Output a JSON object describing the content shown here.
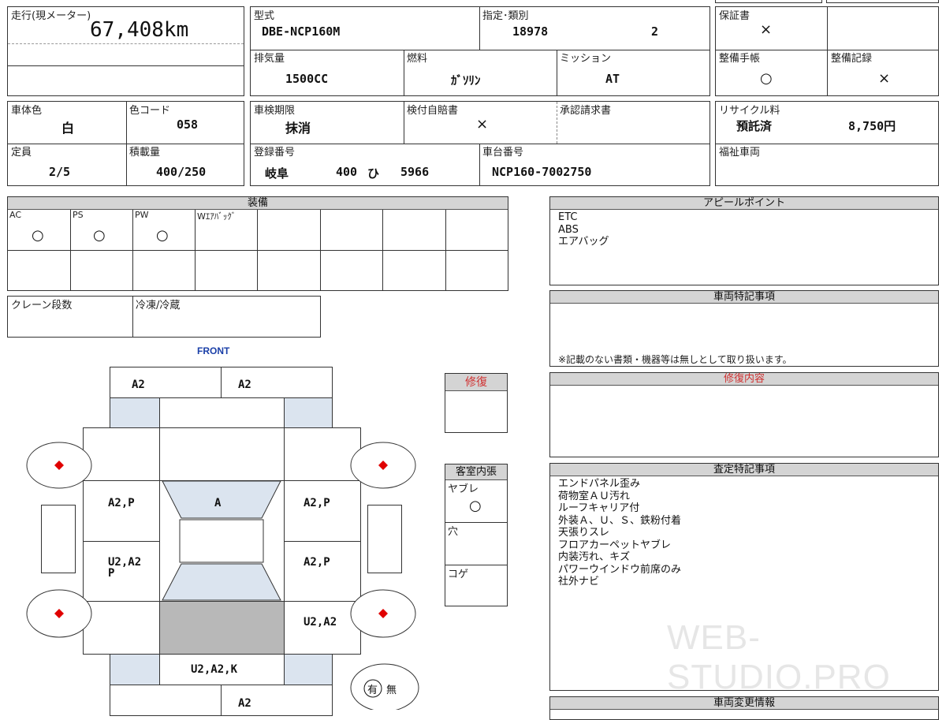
{
  "mileage": {
    "label": "走行(現メーター)",
    "value": "67,408km"
  },
  "model": {
    "label": "型式",
    "value": "DBE-NCP160M"
  },
  "designation": {
    "label": "指定･類別",
    "number": "18978",
    "class": "2"
  },
  "warranty": {
    "label": "保証書",
    "value": "×"
  },
  "displacement": {
    "label": "排気量",
    "value": "1500CC"
  },
  "fuel": {
    "label": "燃料",
    "value": "ｶﾞｿﾘﾝ"
  },
  "transmission": {
    "label": "ミッション",
    "value": "AT"
  },
  "maintenance_notebook": {
    "label": "整備手帳",
    "value": "○"
  },
  "maintenance_record": {
    "label": "整備記録",
    "value": "×"
  },
  "body_color": {
    "label": "車体色",
    "value": "白"
  },
  "color_code": {
    "label": "色コード",
    "value": "058"
  },
  "inspection_expiry": {
    "label": "車検期限",
    "value": "抹消"
  },
  "insurance": {
    "label": "検付自賠書",
    "value": "×"
  },
  "approval_request": {
    "label": "承認請求書",
    "value": ""
  },
  "recycle_fee": {
    "label": "リサイクル料",
    "status": "預託済",
    "amount": "8,750円"
  },
  "capacity": {
    "label": "定員",
    "value": "2/5"
  },
  "load_capacity": {
    "label": "積載量",
    "value": "400/250"
  },
  "registration": {
    "label": "登録番号",
    "region": "岐阜",
    "class": "400",
    "kana": "ひ",
    "number": "5966"
  },
  "chassis": {
    "label": "車台番号",
    "value": "NCP160-7002750"
  },
  "welfare": {
    "label": "福祉車両",
    "value": ""
  },
  "equipment": {
    "title": "装備",
    "items": [
      {
        "label": "AC",
        "mark": "○"
      },
      {
        "label": "PS",
        "mark": "○"
      },
      {
        "label": "PW",
        "mark": "○"
      },
      {
        "label": "Wｴｱﾊﾞｯｸﾞ",
        "mark": ""
      }
    ]
  },
  "crane": {
    "label": "クレーン段数"
  },
  "freezer": {
    "label": "冷凍/冷蔵"
  },
  "appeal": {
    "title": "アピールポイント",
    "text": "ETC\nABS\nエアバッグ"
  },
  "special_notes": {
    "title": "車両特記事項",
    "footer": "※記載のない書類・機器等は無しとして取り扱います。"
  },
  "repair": {
    "title": "修復"
  },
  "repair_details": {
    "title": "修復内容"
  },
  "assessment": {
    "title": "査定特記事項",
    "text": "エンドパネル歪み\n荷物室ＡＵ汚れ\nルーフキャリア付\n外装Ａ、Ｕ、Ｓ、鉄粉付着\n天張りスレ\nフロアカーペットヤブレ\n内装汚れ、キズ\nパワーウインドウ前席のみ\n社外ナビ"
  },
  "changes": {
    "title": "車両変更情報"
  },
  "interior": {
    "title": "客室内張",
    "items": [
      {
        "label": "ヤブレ",
        "mark": "○"
      },
      {
        "label": "穴",
        "mark": ""
      },
      {
        "label": "コゲ",
        "mark": ""
      }
    ]
  },
  "diagram": {
    "front": "FRONT",
    "front_bumper_left": "A2",
    "front_bumper_right": "A2",
    "left_front": "A2,P",
    "right_front": "A2,P",
    "hood": "A",
    "left_rear_door": "U2,A2",
    "left_rear_door_2": "P",
    "right_rear_door": "A2,P",
    "right_quarter": "U2,A2",
    "rear_bumper": "U2,A2,K",
    "rear_bottom": "A2"
  },
  "ownership": {
    "yes": "有",
    "no": "無"
  },
  "watermark": "WEB-STUDIO.PRO",
  "colors": {
    "header_bg": "#d4d4d4",
    "repair_red": "#d03030",
    "diamond_red": "#e00000",
    "front_blue": "#1a3fa8",
    "panel_blue": "#dbe4ef",
    "gray_panel": "#b8b8b8"
  }
}
